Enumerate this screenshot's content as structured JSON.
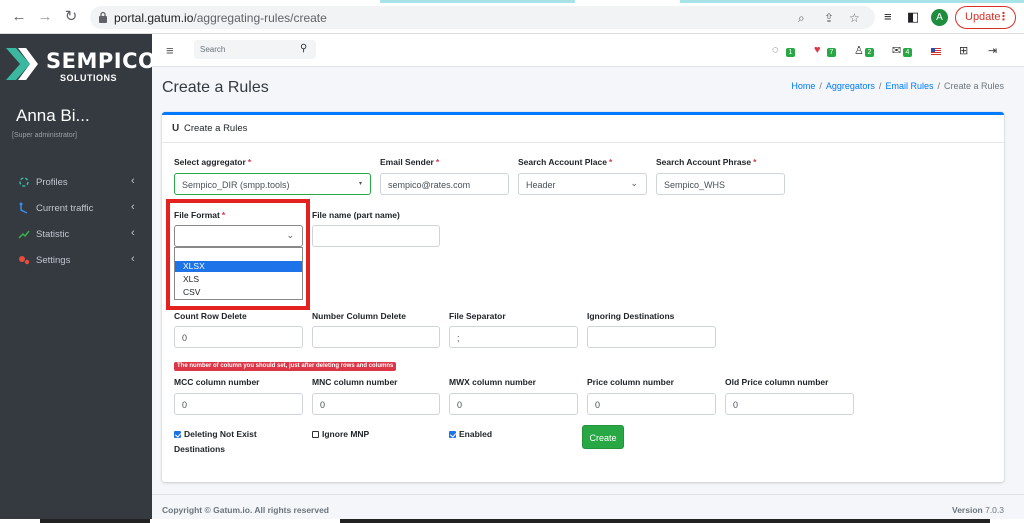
{
  "browser": {
    "url_domain": "portal.gatum.io",
    "url_path": "/aggregating-rules/create",
    "avatar_letter": "A",
    "update_label": "Update"
  },
  "sidebar": {
    "logo_name": "SEMPICO",
    "logo_sub": "SOLUTIONS",
    "user_name": "Anna Bi...",
    "user_role": "[Super administrator]",
    "items": [
      {
        "label": "Profiles",
        "icon": "users-icon"
      },
      {
        "label": "Current traffic",
        "icon": "traffic-icon"
      },
      {
        "label": "Statistic",
        "icon": "chart-icon"
      },
      {
        "label": "Settings",
        "icon": "gears-icon"
      }
    ]
  },
  "navbar": {
    "search_placeholder": "Search",
    "badges": [
      "1",
      "7",
      "2",
      "4"
    ]
  },
  "page": {
    "title": "Create a Rules",
    "breadcrumb": [
      "Home",
      "Aggregators",
      "Email Rules",
      "Create a Rules"
    ],
    "card_title": "Create a Rules"
  },
  "form": {
    "select_aggregator": {
      "label": "Select aggregator",
      "value": "Sempico_DIR (smpp.tools)"
    },
    "email_sender": {
      "label": "Email Sender",
      "value": "sempico@rates.com"
    },
    "search_account_place": {
      "label": "Search Account Place",
      "value": "Header"
    },
    "search_account_phrase": {
      "label": "Search Account Phrase",
      "value": "Sempico_WHS"
    },
    "file_format": {
      "label": "File Format",
      "value": "",
      "options": [
        "XLSX",
        "XLS",
        "CSV"
      ]
    },
    "file_name": {
      "label": "File name (part name)",
      "value": ""
    },
    "count_row_delete": {
      "label": "Count Row Delete",
      "value": "0"
    },
    "number_column_delete": {
      "label": "Number Column Delete",
      "value": ""
    },
    "file_separator": {
      "label": "File Separator",
      "value": ";"
    },
    "ignoring_destinations": {
      "label": "Ignoring Destinations",
      "value": ""
    },
    "column_note": "The number of column you should set, just after deleting rows and columns",
    "mcc_column": {
      "label": "MCC column number",
      "value": "0"
    },
    "mnc_column": {
      "label": "MNC column number",
      "value": "0"
    },
    "mwx_column": {
      "label": "MWX column number",
      "value": "0"
    },
    "price_column": {
      "label": "Price column number",
      "value": "0"
    },
    "old_price_column": {
      "label": "Old Price column number",
      "value": "0"
    },
    "deleting_not_exist_line1": "Deleting Not Exist",
    "deleting_not_exist_line2": "Destinations",
    "ignore_mnp": "Ignore MNP",
    "enabled": "Enabled",
    "create_label": "Create"
  },
  "footer": {
    "copyright": "Copyright © Gatum.io. All rights reserved",
    "version_label": "Version",
    "version_value": "7.0.3"
  }
}
